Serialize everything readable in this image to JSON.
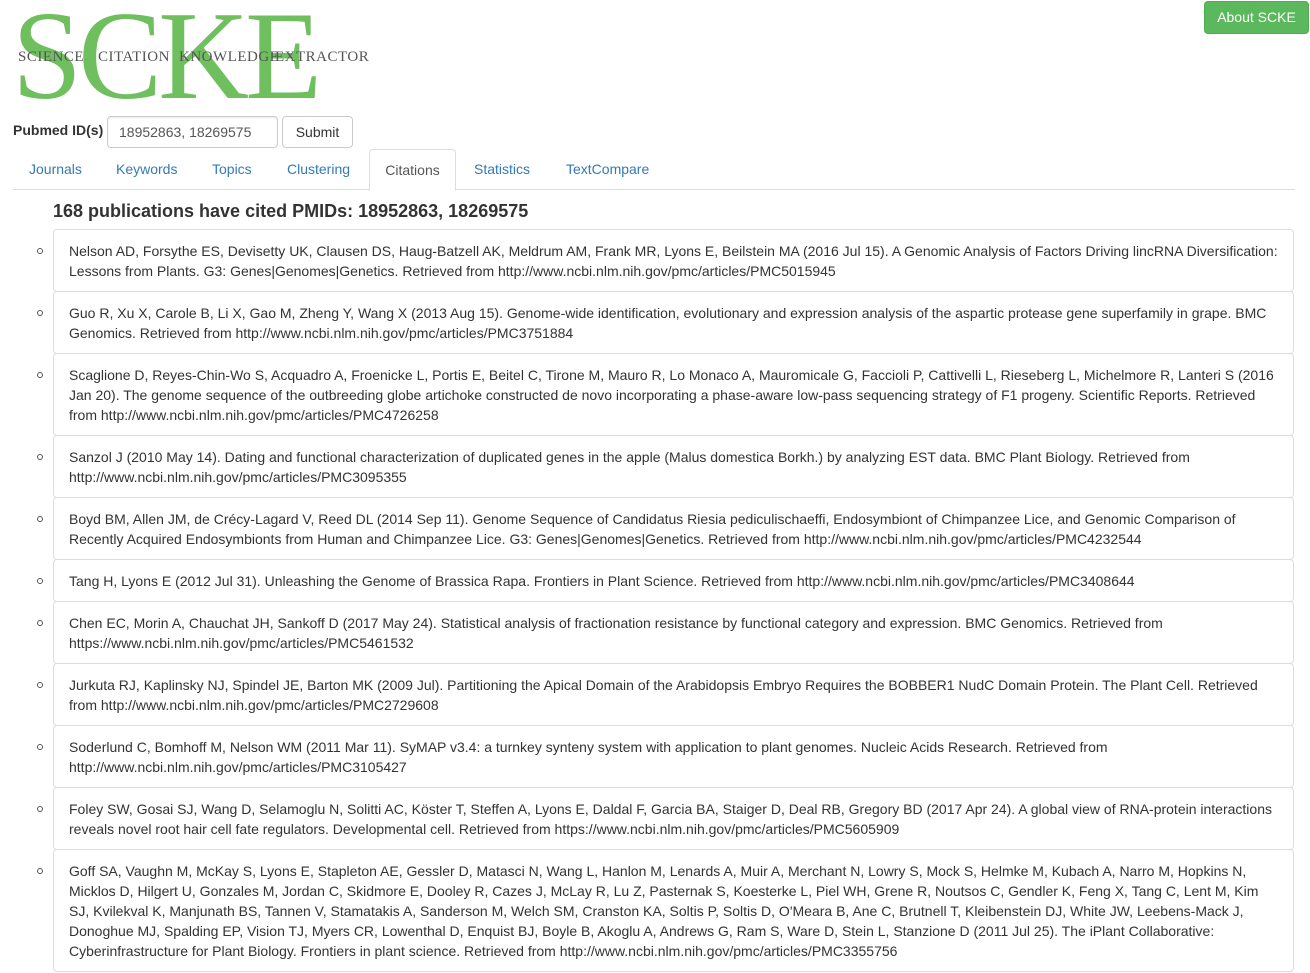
{
  "logo": {
    "big": "SCKE",
    "words": [
      "SCIENCE",
      "CITATION",
      "KNOWLEDGE",
      "EXTRACTOR"
    ]
  },
  "header": {
    "about_label": "About SCKE"
  },
  "form": {
    "label": "Pubmed ID(s)",
    "input_value": "18952863, 18269575",
    "submit_label": "Submit"
  },
  "tabs": [
    "Journals",
    "Keywords",
    "Topics",
    "Clustering",
    "Citations",
    "Statistics",
    "TextCompare"
  ],
  "active_tab": "Citations",
  "main": {
    "heading": "168 publications have cited PMIDs: 18952863, 18269575"
  },
  "citations": [
    "Nelson AD, Forsythe ES, Devisetty UK, Clausen DS, Haug-Batzell AK, Meldrum AM, Frank MR, Lyons E, Beilstein MA (2016 Jul 15). A Genomic Analysis of Factors Driving lincRNA Diversification: Lessons from Plants. G3: Genes|Genomes|Genetics. Retrieved from http://www.ncbi.nlm.nih.gov/pmc/articles/PMC5015945",
    "Guo R, Xu X, Carole B, Li X, Gao M, Zheng Y, Wang X (2013 Aug 15). Genome-wide identification, evolutionary and expression analysis of the aspartic protease gene superfamily in grape. BMC Genomics. Retrieved from http://www.ncbi.nlm.nih.gov/pmc/articles/PMC3751884",
    "Scaglione D, Reyes-Chin-Wo S, Acquadro A, Froenicke L, Portis E, Beitel C, Tirone M, Mauro R, Lo Monaco A, Mauromicale G, Faccioli P, Cattivelli L, Rieseberg L, Michelmore R, Lanteri S (2016 Jan 20). The genome sequence of the outbreeding globe artichoke constructed de novo incorporating a phase-aware low-pass sequencing strategy of F1 progeny. Scientific Reports. Retrieved from http://www.ncbi.nlm.nih.gov/pmc/articles/PMC4726258",
    "Sanzol J (2010 May 14). Dating and functional characterization of duplicated genes in the apple (Malus domestica Borkh.) by analyzing EST data. BMC Plant Biology. Retrieved from http://www.ncbi.nlm.nih.gov/pmc/articles/PMC3095355",
    "Boyd BM, Allen JM, de Crécy-Lagard V, Reed DL (2014 Sep 11). Genome Sequence of Candidatus Riesia pediculischaeffi, Endosymbiont of Chimpanzee Lice, and Genomic Comparison of Recently Acquired Endosymbionts from Human and Chimpanzee Lice. G3: Genes|Genomes|Genetics. Retrieved from http://www.ncbi.nlm.nih.gov/pmc/articles/PMC4232544",
    "Tang H, Lyons E (2012 Jul 31). Unleashing the Genome of Brassica Rapa. Frontiers in Plant Science. Retrieved from http://www.ncbi.nlm.nih.gov/pmc/articles/PMC3408644",
    "Chen EC, Morin A, Chauchat JH, Sankoff D (2017 May 24). Statistical analysis of fractionation resistance by functional category and expression. BMC Genomics. Retrieved from https://www.ncbi.nlm.nih.gov/pmc/articles/PMC5461532",
    "Jurkuta RJ, Kaplinsky NJ, Spindel JE, Barton MK (2009 Jul). Partitioning the Apical Domain of the Arabidopsis Embryo Requires the BOBBER1 NudC Domain Protein. The Plant Cell. Retrieved from http://www.ncbi.nlm.nih.gov/pmc/articles/PMC2729608",
    "Soderlund C, Bomhoff M, Nelson WM (2011 Mar 11). SyMAP v3.4: a turnkey synteny system with application to plant genomes. Nucleic Acids Research. Retrieved from http://www.ncbi.nlm.nih.gov/pmc/articles/PMC3105427",
    "Foley SW, Gosai SJ, Wang D, Selamoglu N, Solitti AC, Köster T, Steffen A, Lyons E, Daldal F, Garcia BA, Staiger D, Deal RB, Gregory BD (2017 Apr 24). A global view of RNA-protein interactions reveals novel root hair cell fate regulators. Developmental cell. Retrieved from https://www.ncbi.nlm.nih.gov/pmc/articles/PMC5605909",
    "Goff SA, Vaughn M, McKay S, Lyons E, Stapleton AE, Gessler D, Matasci N, Wang L, Hanlon M, Lenards A, Muir A, Merchant N, Lowry S, Mock S, Helmke M, Kubach A, Narro M, Hopkins N, Micklos D, Hilgert U, Gonzales M, Jordan C, Skidmore E, Dooley R, Cazes J, McLay R, Lu Z, Pasternak S, Koesterke L, Piel WH, Grene R, Noutsos C, Gendler K, Feng X, Tang C, Lent M, Kim SJ, Kvilekval K, Manjunath BS, Tannen V, Stamatakis A, Sanderson M, Welch SM, Cranston KA, Soltis P, Soltis D, O'Meara B, Ane C, Brutnell T, Kleibenstein DJ, White JW, Leebens-Mack J, Donoghue MJ, Spalding EP, Vision TJ, Myers CR, Lowenthal D, Enquist BJ, Boyle B, Akoglu A, Andrews G, Ram S, Ware D, Stein L, Stanzione D (2011 Jul 25). The iPlant Collaborative: Cyberinfrastructure for Plant Biology. Frontiers in plant science. Retrieved from http://www.ncbi.nlm.nih.gov/pmc/articles/PMC3355756"
  ]
}
